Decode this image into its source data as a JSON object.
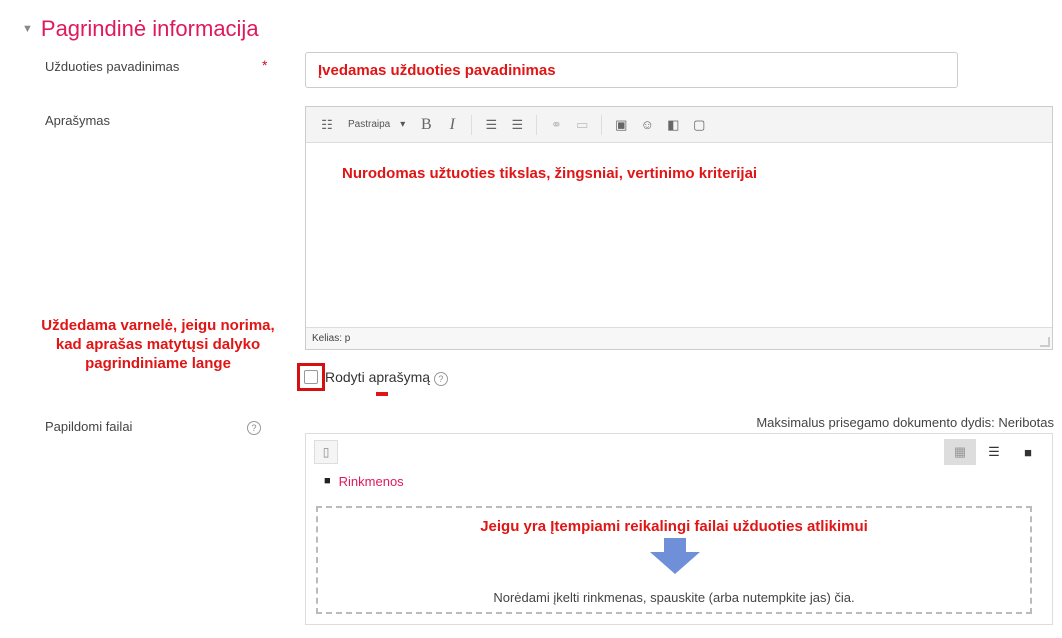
{
  "section": {
    "caret": "▼",
    "title": "Pagrindinė informacija"
  },
  "fields": {
    "name_label": "Užduoties pavadinimas",
    "required_mark": "*",
    "name_annotation": "Įvedamas užduoties pavadinimas",
    "description_label": "Aprašymas",
    "extra_files_label": "Papildomi failai"
  },
  "editor": {
    "format_select": "Pastraipa",
    "annotation": "Nurodomas užtuoties tikslas, žingsniai, vertinimo kriterijai",
    "path": "Kelias: p"
  },
  "side_annotation": "Uždedama varnelė, jeigu norima, kad aprašas matytųsi dalyko pagrindiniame lange",
  "show_description": {
    "label": "Rodyti aprašymą",
    "checked": false
  },
  "files": {
    "max_size": "Maksimalus prisegamo dokumento dydis: Neribotas",
    "folder_link": "Rinkmenos",
    "annotation": "Jeigu yra Įtempiami reikalingi failai užduoties atlikimui",
    "drop_hint": "Norėdami įkelti rinkmenas, spauskite (arba nutempkite jas) čia."
  },
  "colors": {
    "accent": "#e0195a",
    "annotation": "#e01515",
    "drop_arrow": "#6f8fd8"
  }
}
